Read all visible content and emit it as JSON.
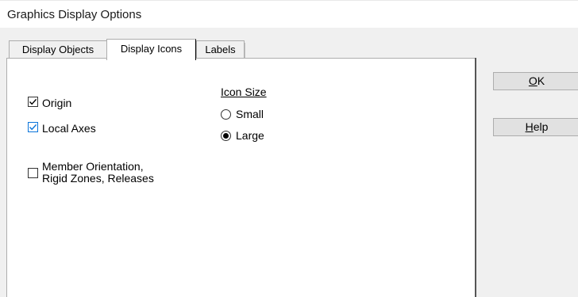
{
  "window": {
    "title": "Graphics Display Options"
  },
  "tabs": [
    {
      "label": "Display Objects",
      "active": false
    },
    {
      "label": "Display Icons",
      "active": true
    },
    {
      "label": "Labels",
      "active": false
    }
  ],
  "checkboxes": [
    {
      "label": "Origin",
      "checked": true
    },
    {
      "label": "Local Axes",
      "checked": true
    },
    {
      "label_line1": "Member Orientation,",
      "label_line2": "Rigid Zones, Releases",
      "checked": false
    }
  ],
  "icon_size": {
    "title": "Icon Size",
    "options": [
      {
        "label": "Small",
        "selected": false
      },
      {
        "label": "Large",
        "selected": true
      }
    ]
  },
  "buttons": {
    "ok": {
      "mnemonic": "O",
      "rest": "K"
    },
    "help": {
      "mnemonic": "H",
      "rest": "elp"
    }
  },
  "colors": {
    "checkbox_focus": "#0a74da",
    "dialog_bg": "#f0f0f0",
    "button_bg": "#e1e1e1"
  }
}
